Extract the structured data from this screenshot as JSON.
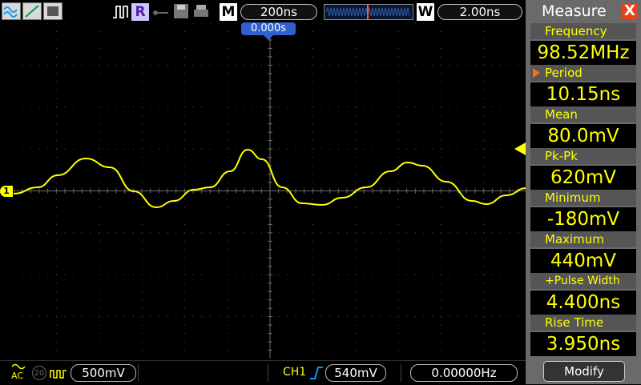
{
  "topbar": {
    "run_indicator": "R",
    "timebase_label": "M",
    "timebase_value": "200ns",
    "window_label": "W",
    "window_value": "2.00ns"
  },
  "screen": {
    "trigger_position": "0.000s",
    "ch1_marker": "1"
  },
  "bottombar": {
    "coupling": "AC",
    "bw_limit": "20",
    "ch1_scale": "500mV",
    "trigger_source": "CH1",
    "trigger_level": "540mV",
    "frequency_counter": "0.00000Hz"
  },
  "measure": {
    "title": "Measure",
    "close_label": "X",
    "items": [
      {
        "label": "Frequency",
        "value": "98.52MHz"
      },
      {
        "label": "Period",
        "value": "10.15ns"
      },
      {
        "label": "Mean",
        "value": "80.0mV"
      },
      {
        "label": "Pk-Pk",
        "value": "620mV"
      },
      {
        "label": "Minimum",
        "value": "-180mV"
      },
      {
        "label": "Maximum",
        "value": "440mV"
      },
      {
        "label": "+Pulse Width",
        "value": "4.400ns"
      },
      {
        "label": "Rise Time",
        "value": "3.950ns"
      }
    ],
    "modify_label": "Modify"
  },
  "colors": {
    "trace": "#ffff00",
    "trigger_marker": "#2f5fd0",
    "panel": "#6a6a6a"
  }
}
